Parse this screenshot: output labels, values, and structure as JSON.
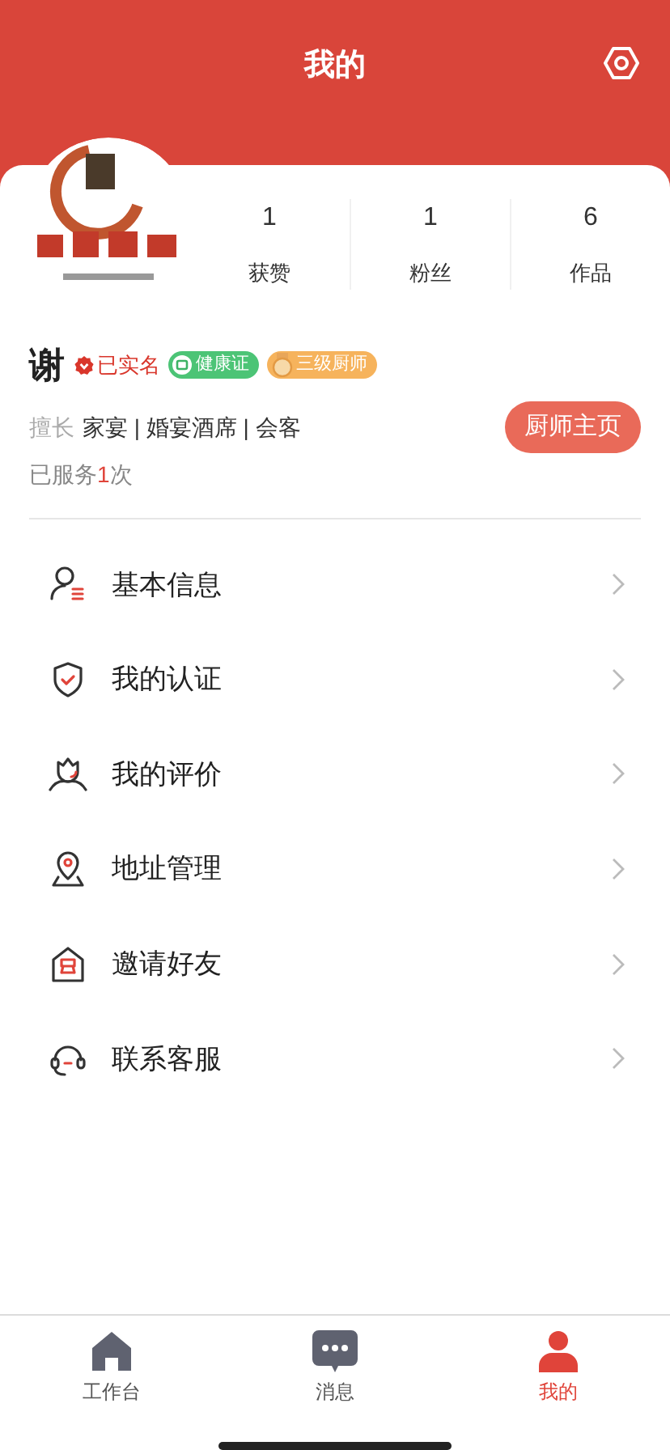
{
  "header": {
    "title": "我的"
  },
  "profile": {
    "stats": [
      {
        "value": "1",
        "label": "获赞"
      },
      {
        "value": "1",
        "label": "粉丝"
      },
      {
        "value": "6",
        "label": "作品"
      }
    ],
    "name": "谢",
    "badges": [
      {
        "kind": "verified",
        "label": "已实名"
      },
      {
        "kind": "health",
        "label": "健康证"
      },
      {
        "kind": "chef",
        "label": "三级厨师"
      }
    ],
    "specialty_label": "擅长",
    "specialty": "家宴 | 婚宴酒席 | 会客",
    "homepage_button": "厨师主页",
    "served": {
      "prefix": "已服务",
      "count": "1",
      "suffix": "次"
    }
  },
  "menu": [
    {
      "kind": "profile",
      "label": "基本信息"
    },
    {
      "kind": "certification",
      "label": "我的认证"
    },
    {
      "kind": "reviews",
      "label": "我的评价"
    },
    {
      "kind": "address",
      "label": "地址管理"
    },
    {
      "kind": "invite",
      "label": "邀请好友"
    },
    {
      "kind": "support",
      "label": "联系客服"
    }
  ],
  "tab_bar": [
    {
      "kind": "home",
      "label": "工作台",
      "selected": false
    },
    {
      "kind": "messages",
      "label": "消息",
      "selected": false
    },
    {
      "kind": "me",
      "label": "我的",
      "selected": true
    }
  ]
}
